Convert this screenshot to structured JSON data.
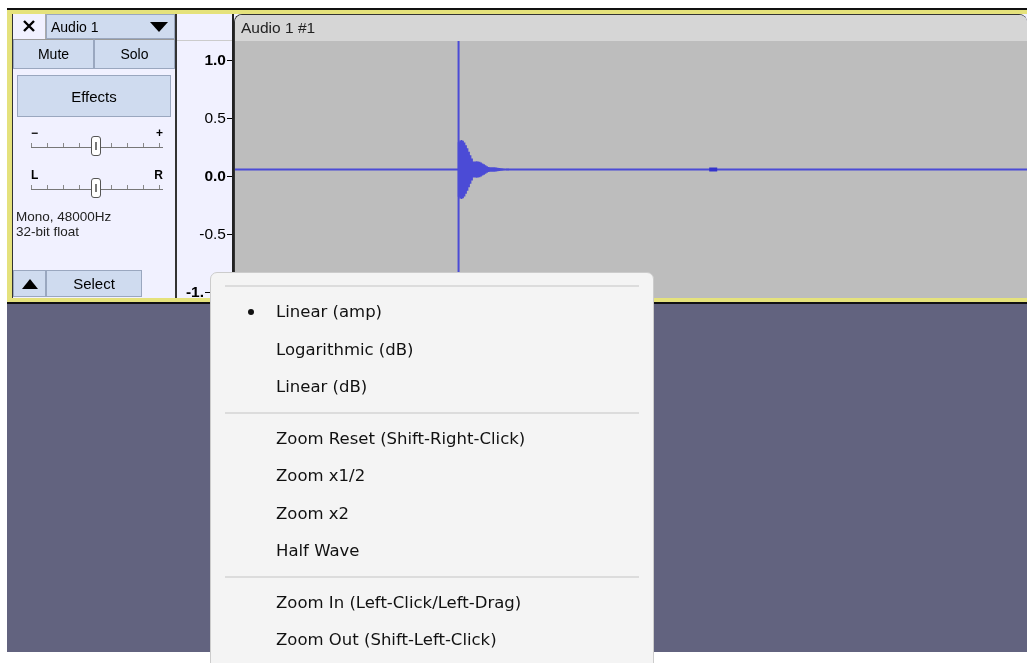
{
  "track": {
    "name": "Audio 1",
    "buttons": [
      "Mute",
      "Solo"
    ],
    "effects": "Effects",
    "gain": {
      "min_label": "−",
      "max_label": "+",
      "level": 0.5
    },
    "pan": {
      "min_label": "L",
      "max_label": "R",
      "level": 0.5
    },
    "info": [
      "Mono, 48000Hz",
      "32-bit float"
    ],
    "select": "Select"
  },
  "ruler": {
    "ticks": [
      "1.0",
      "0.5",
      "0.0",
      "-0.5",
      "-1."
    ]
  },
  "clip": {
    "title": "Audio 1 #1"
  },
  "menu": {
    "sections": [
      [
        {
          "label": "Linear (amp)",
          "kind": "radio",
          "selected": true
        },
        {
          "label": "Logarithmic (dB)",
          "kind": "radio",
          "selected": false
        },
        {
          "label": "Linear (dB)",
          "kind": "radio",
          "selected": false
        }
      ],
      [
        {
          "label": "Zoom Reset (Shift-Right-Click)",
          "kind": "command"
        },
        {
          "label": "Zoom x1/2",
          "kind": "command"
        },
        {
          "label": "Zoom x2",
          "kind": "command"
        },
        {
          "label": "Half Wave",
          "kind": "command"
        }
      ],
      [
        {
          "label": "Zoom In (Left-Click/Left-Drag)",
          "kind": "command"
        },
        {
          "label": "Zoom Out (Shift-Left-Click)",
          "kind": "command"
        }
      ]
    ]
  }
}
